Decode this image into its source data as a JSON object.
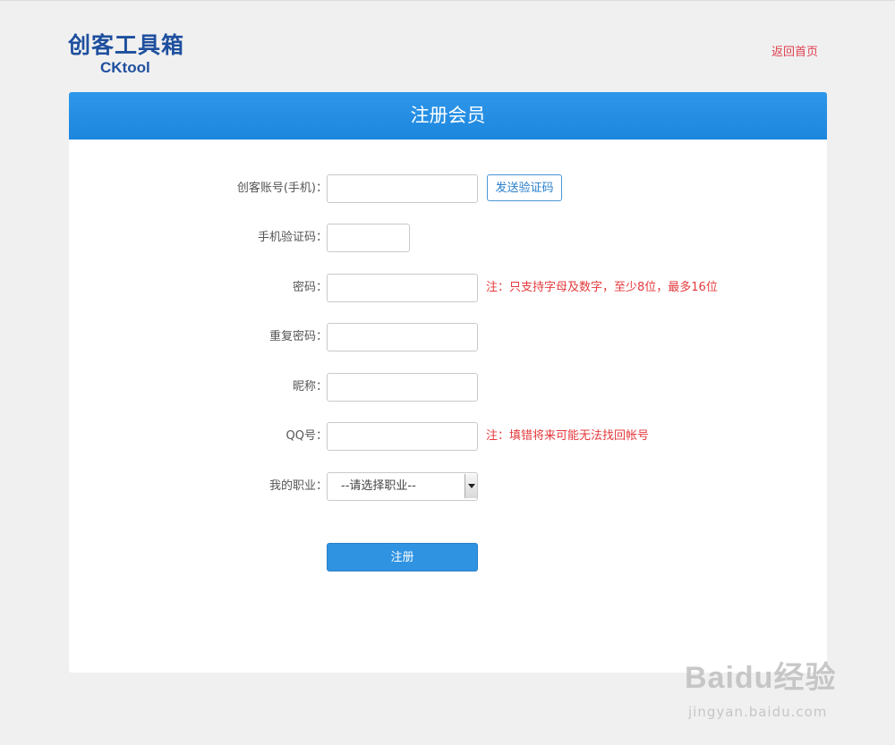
{
  "logo": {
    "cn": "创客工具箱",
    "en": "CKtool"
  },
  "header_link": "返回首页",
  "form": {
    "title": "注册会员",
    "fields": [
      {
        "label": "创客账号(手机)：",
        "button": "发送验证码"
      },
      {
        "label": "手机验证码："
      },
      {
        "label": "密码：",
        "note": "注：只支持字母及数字，至少8位，最多16位"
      },
      {
        "label": "重复密码："
      },
      {
        "label": "昵称："
      },
      {
        "label": "QQ号：",
        "note": "注：填错将来可能无法找回帐号"
      },
      {
        "label": "我的职业：",
        "select_value": "--请选择职业--"
      }
    ],
    "submit_label": "注册"
  },
  "watermark": {
    "brand": "Baidu经验",
    "url": "jingyan.baidu.com"
  },
  "colors": {
    "header_blue": "#1c86de",
    "note_red": "#e4393c",
    "logo_blue": "#1e4f9e"
  }
}
